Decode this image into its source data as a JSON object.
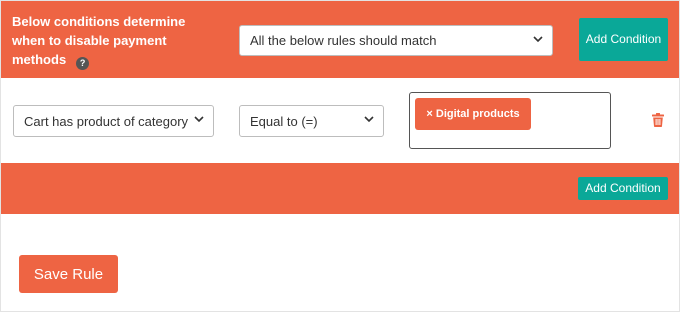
{
  "colors": {
    "accent": "#ee6443",
    "teal": "#0aa898",
    "help_icon": "#555555",
    "trash": "#ee6443"
  },
  "header": {
    "heading": "Below conditions determine when to disable payment methods",
    "help_icon": "?",
    "match_select_value": "All the below rules should match",
    "add_condition_label": "Add Condition"
  },
  "rule": {
    "condition_select_value": "Cart has product of category",
    "operator_select_value": "Equal to (=)",
    "tag_label": "× Digital products",
    "delete_icon": "trash-icon"
  },
  "footer": {
    "add_condition_label": "Add Condition",
    "save_label": "Save Rule"
  }
}
